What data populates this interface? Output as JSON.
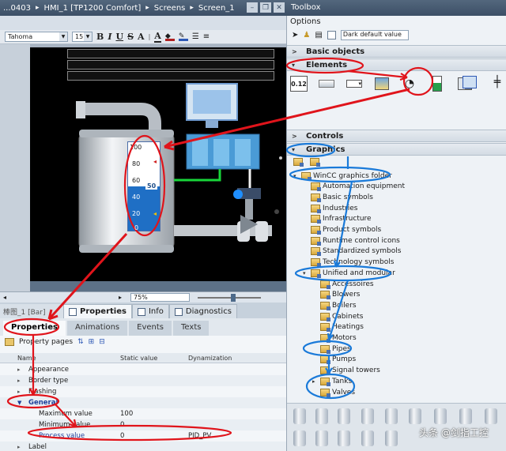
{
  "title_bar": {
    "crumbs": [
      "...0403",
      "HMI_1 [TP1200 Comfort]",
      "Screens",
      "Screen_1"
    ],
    "separator": "▸"
  },
  "toolbox": {
    "title": "Toolbox",
    "options_label": "Options",
    "style_select": "Dark default value",
    "sections": {
      "basic_objects": "Basic objects",
      "elements": "Elements",
      "controls": "Controls",
      "graphics": "Graphics"
    },
    "element_labels": [
      "0.12"
    ],
    "tree": [
      {
        "label": "WinCC graphics folder",
        "level": 0,
        "expanded": true
      },
      {
        "label": "Automation equipment",
        "level": 1
      },
      {
        "label": "Basic symbols",
        "level": 1
      },
      {
        "label": "Industries",
        "level": 1
      },
      {
        "label": "Infrastructure",
        "level": 1
      },
      {
        "label": "Product symbols",
        "level": 1
      },
      {
        "label": "Runtime control icons",
        "level": 1
      },
      {
        "label": "Standardized symbols",
        "level": 1
      },
      {
        "label": "Technology symbols",
        "level": 1
      },
      {
        "label": "Unified and modular",
        "level": 1,
        "expanded": true
      },
      {
        "label": "Accessoires",
        "level": 2
      },
      {
        "label": "Blowers",
        "level": 2
      },
      {
        "label": "Boilers",
        "level": 2
      },
      {
        "label": "Cabinets",
        "level": 2
      },
      {
        "label": "Heatings",
        "level": 2
      },
      {
        "label": "Motors",
        "level": 2
      },
      {
        "label": "Pipes",
        "level": 2
      },
      {
        "label": "Pumps",
        "level": 2
      },
      {
        "label": "Signal towers",
        "level": 2
      },
      {
        "label": "Tanks",
        "level": 2,
        "expandable": true
      },
      {
        "label": "Valves",
        "level": 2
      }
    ]
  },
  "format_toolbar": {
    "font": "Tahoma",
    "size": "15",
    "buttons": [
      "B",
      "I",
      "U",
      "S",
      "A",
      "A"
    ]
  },
  "editor": {
    "zoom": "75%",
    "bar_scale": [
      "100",
      "80",
      "60",
      "40",
      "20",
      "0"
    ],
    "bar_value_label": "50",
    "bar_fill_fraction": 0.5
  },
  "inspector": {
    "object_name": "棒图_1 [Bar]",
    "tabs": [
      "Properties",
      "Info",
      "Diagnostics"
    ],
    "prop_tabs": [
      "Properties",
      "Animations",
      "Events",
      "Texts"
    ],
    "property_pages_label": "Property pages",
    "table_headers": {
      "name": "Name",
      "static": "Static value",
      "dyn": "Dynamization"
    },
    "rows": [
      {
        "name": "Appearance",
        "static": "",
        "dyn": "",
        "type": "group"
      },
      {
        "name": "Border type",
        "static": "",
        "dyn": "",
        "type": "group"
      },
      {
        "name": "Flashing",
        "static": "",
        "dyn": "",
        "type": "group"
      },
      {
        "name": "General",
        "static": "",
        "dyn": "",
        "type": "general"
      },
      {
        "name": "Maximum value",
        "static": "100",
        "dyn": "",
        "type": "sub"
      },
      {
        "name": "Minimum value",
        "static": "0",
        "dyn": "",
        "type": "sub"
      },
      {
        "name": "Process value",
        "static": "0",
        "dyn": "PID_PV",
        "type": "pv"
      },
      {
        "name": "Label",
        "static": "",
        "dyn": "",
        "type": "group"
      }
    ]
  },
  "watermark": "头条 @剑指工控",
  "colors": {
    "annotation_red": "#e0141b",
    "annotation_blue": "#1a7ad9",
    "bar_fill": "#1f6fc5",
    "header_dark": "#3c4f66"
  }
}
